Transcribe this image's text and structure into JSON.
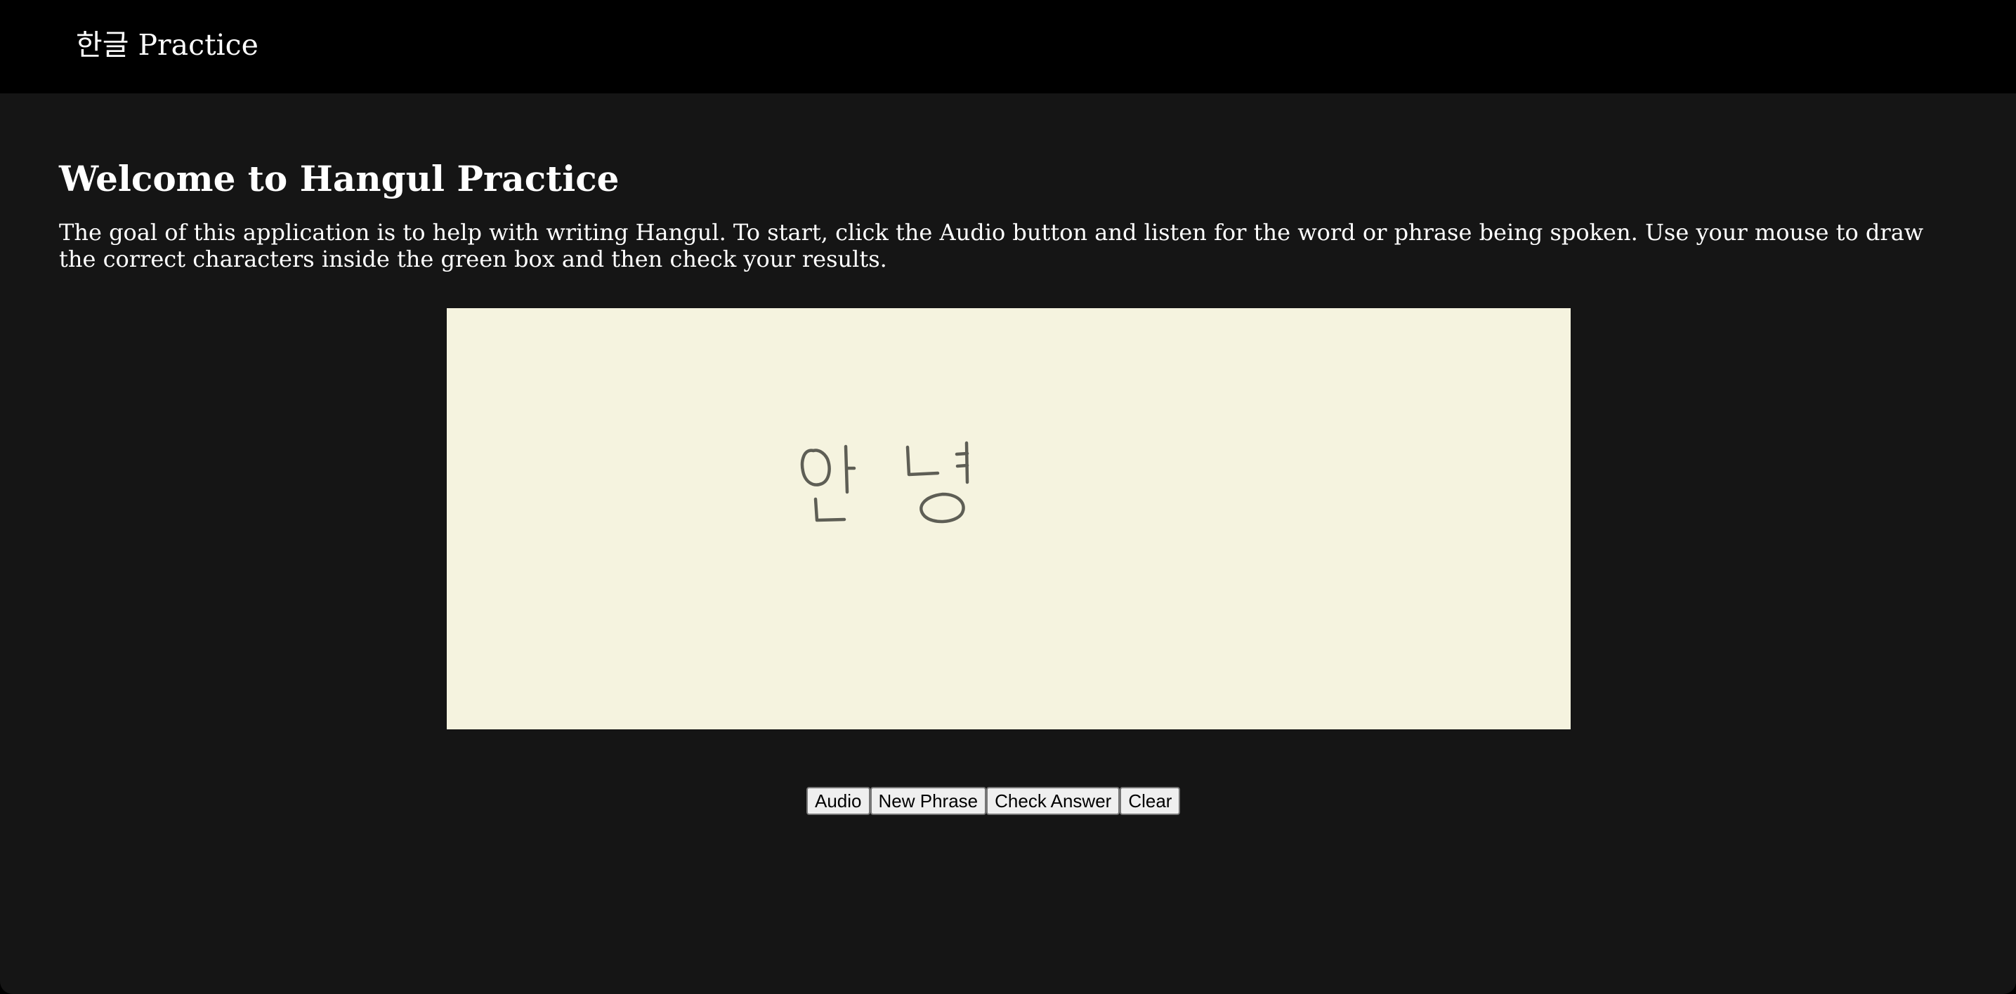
{
  "header": {
    "brand": "한글 Practice"
  },
  "main": {
    "title": "Welcome to Hangul Practice",
    "intro": "The goal of this application is to help with writing Hangul. To start, click the Audio button and listen for the word or phrase being spoken. Use your mouse to draw the correct characters inside the green box and then check your results."
  },
  "canvas": {
    "background_color": "#f5f3df",
    "ink_color": "#5e5e55",
    "drawing": "안녕"
  },
  "buttons": {
    "audio": "Audio",
    "new_phrase": "New Phrase",
    "check_answer": "Check Answer",
    "clear": "Clear"
  },
  "colors": {
    "header_bg": "#000000",
    "page_bg": "#151515",
    "text": "#ffffff"
  }
}
